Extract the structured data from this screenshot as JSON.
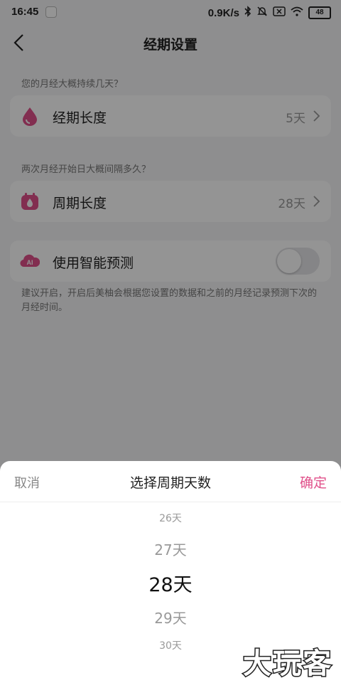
{
  "status_bar": {
    "time": "16:45",
    "net_speed": "0.9K/s",
    "battery": "48",
    "icons": [
      "app-icon",
      "bluetooth-icon",
      "mute-icon",
      "sim-icon",
      "wifi-icon",
      "battery-icon"
    ]
  },
  "header": {
    "title": "经期设置",
    "back_icon": "back-chevron-icon"
  },
  "period_section": {
    "question": "您的月经大概持续几天？",
    "label": "经期长度",
    "value": "5天",
    "icon": "drop-icon"
  },
  "cycle_section": {
    "question": "两次月经开始日大概间隔多久？",
    "label": "周期长度",
    "value": "28天",
    "icon": "calendar-drop-icon"
  },
  "smart_predict": {
    "label": "使用智能预测",
    "icon_text": "AI",
    "enabled": false,
    "note": "建议开启，开启后美柚会根据您设置的数据和之前的月经记录预测下次的月经时间。"
  },
  "picker": {
    "cancel": "取消",
    "title": "选择周期天数",
    "confirm": "确定",
    "options": [
      "26天",
      "27天",
      "28天",
      "29天",
      "30天"
    ],
    "selected": "28天"
  },
  "watermark": "大玩客",
  "colors": {
    "accent": "#e0508a",
    "background": "#f5f5f7",
    "overlay": "rgba(0,0,0,0.42)"
  }
}
